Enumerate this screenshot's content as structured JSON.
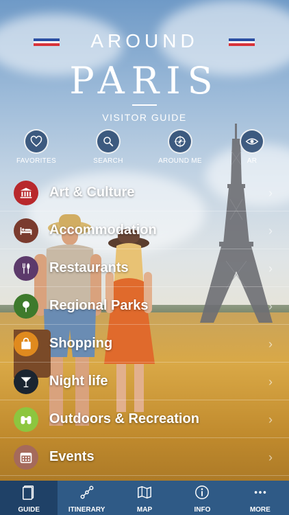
{
  "header": {
    "title_top": "AROUND",
    "title_main": "PARIS",
    "subtitle": "VISITOR GUIDE"
  },
  "quick_actions": [
    {
      "label": "FAVORITES",
      "icon": "heart-icon"
    },
    {
      "label": "SEARCH",
      "icon": "search-icon"
    },
    {
      "label": "AROUND ME",
      "icon": "compass-icon"
    },
    {
      "label": "AR",
      "icon": "eye-icon"
    }
  ],
  "menu": [
    {
      "label": "Art & Culture",
      "icon": "museum-icon",
      "color": "#b8282c"
    },
    {
      "label": "Accommodation",
      "icon": "bed-icon",
      "color": "#7a3b2e"
    },
    {
      "label": "Restaurants",
      "icon": "cutlery-icon",
      "color": "#5c3a6b"
    },
    {
      "label": "Regional Parks",
      "icon": "tree-icon",
      "color": "#3e7a2c"
    },
    {
      "label": "Shopping",
      "icon": "shopping-bag-icon",
      "color": "#e08a1e"
    },
    {
      "label": "Night life",
      "icon": "cocktail-icon",
      "color": "#1a2430"
    },
    {
      "label": "Outdoors & Recreation",
      "icon": "binoculars-icon",
      "color": "#8dc63f"
    },
    {
      "label": "Events",
      "icon": "calendar-icon",
      "color": "#a56a5b"
    }
  ],
  "tabs": [
    {
      "label": "GUIDE",
      "icon": "book-icon",
      "active": true
    },
    {
      "label": "ITINERARY",
      "icon": "route-icon",
      "active": false
    },
    {
      "label": "MAP",
      "icon": "map-icon",
      "active": false
    },
    {
      "label": "INFO",
      "icon": "info-icon",
      "active": false
    },
    {
      "label": "MORE",
      "icon": "more-icon",
      "active": false
    }
  ],
  "colors": {
    "tabbar": "#2f5a86",
    "tab_active": "#1f4167",
    "flag_blue": "#2b4fa3",
    "flag_white": "#ffffff",
    "flag_red": "#d8343a"
  }
}
